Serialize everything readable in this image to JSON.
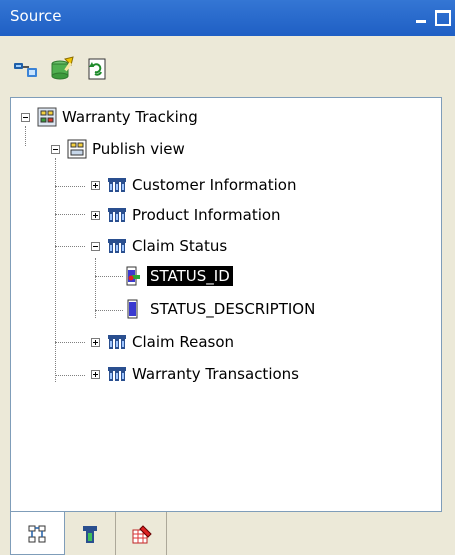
{
  "window": {
    "title": "Source",
    "buttons": [
      "minimize",
      "maximize"
    ]
  },
  "toolbar": {
    "icons": [
      "connect-source-icon",
      "new-view-icon",
      "refresh-icon"
    ]
  },
  "tree": {
    "root": {
      "label": "Warranty Tracking",
      "icon": "project-icon",
      "expanded": true
    },
    "view": {
      "label": "Publish view",
      "icon": "view-icon",
      "expanded": true
    },
    "tables": [
      {
        "label": "Customer Information",
        "icon": "table-icon",
        "expanded": false
      },
      {
        "label": "Product Information",
        "icon": "table-icon",
        "expanded": false
      },
      {
        "label": "Claim Status",
        "icon": "table-icon",
        "expanded": true,
        "columns": [
          {
            "label": "STATUS_ID",
            "icon": "key-column-icon",
            "selected": true
          },
          {
            "label": "STATUS_DESCRIPTION",
            "icon": "column-icon",
            "selected": false
          }
        ]
      },
      {
        "label": "Claim Reason",
        "icon": "table-icon",
        "expanded": false
      },
      {
        "label": "Warranty Transactions",
        "icon": "table-icon",
        "expanded": false
      }
    ]
  },
  "bottom_tabs": [
    {
      "name": "source-tab",
      "icon": "source-tree-icon",
      "active": true
    },
    {
      "name": "table-tab",
      "icon": "table-view-icon",
      "active": false
    },
    {
      "name": "edit-tab",
      "icon": "edit-table-icon",
      "active": false
    }
  ]
}
